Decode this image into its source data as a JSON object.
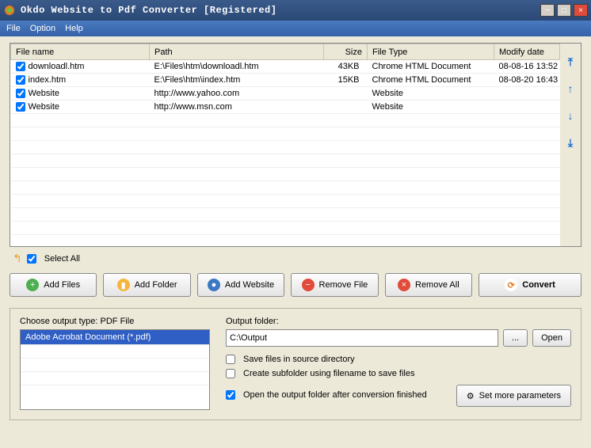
{
  "window": {
    "title": "Okdo Website to Pdf Converter [Registered]"
  },
  "menu": {
    "file": "File",
    "option": "Option",
    "help": "Help"
  },
  "columns": {
    "name": "File name",
    "path": "Path",
    "size": "Size",
    "type": "File Type",
    "date": "Modify date"
  },
  "files": [
    {
      "name": "downloadl.htm",
      "path": "E:\\Files\\htm\\downloadl.htm",
      "size": "43KB",
      "type": "Chrome HTML Document",
      "date": "08-08-16 13:52"
    },
    {
      "name": "index.htm",
      "path": "E:\\Files\\htm\\index.htm",
      "size": "15KB",
      "type": "Chrome HTML Document",
      "date": "08-08-20 16:43"
    },
    {
      "name": "Website",
      "path": "http://www.yahoo.com",
      "size": "",
      "type": "Website",
      "date": ""
    },
    {
      "name": "Website",
      "path": "http://www.msn.com",
      "size": "",
      "type": "Website",
      "date": ""
    }
  ],
  "selectall": "Select All",
  "buttons": {
    "addfiles": "Add Files",
    "addfolder": "Add Folder",
    "addwebsite": "Add Website",
    "removefile": "Remove File",
    "removeall": "Remove All",
    "convert": "Convert"
  },
  "output": {
    "chooseTypeLabel": "Choose output type:",
    "pdfFile": "PDF File",
    "typeItem": "Adobe Acrobat Document (*.pdf)",
    "folderLabel": "Output folder:",
    "folderValue": "C:\\Output",
    "browse": "...",
    "open": "Open",
    "saveSource": "Save files in source directory",
    "createSub": "Create subfolder using filename to save files",
    "openAfter": "Open the output folder after conversion finished",
    "moreParams": "Set more parameters"
  }
}
